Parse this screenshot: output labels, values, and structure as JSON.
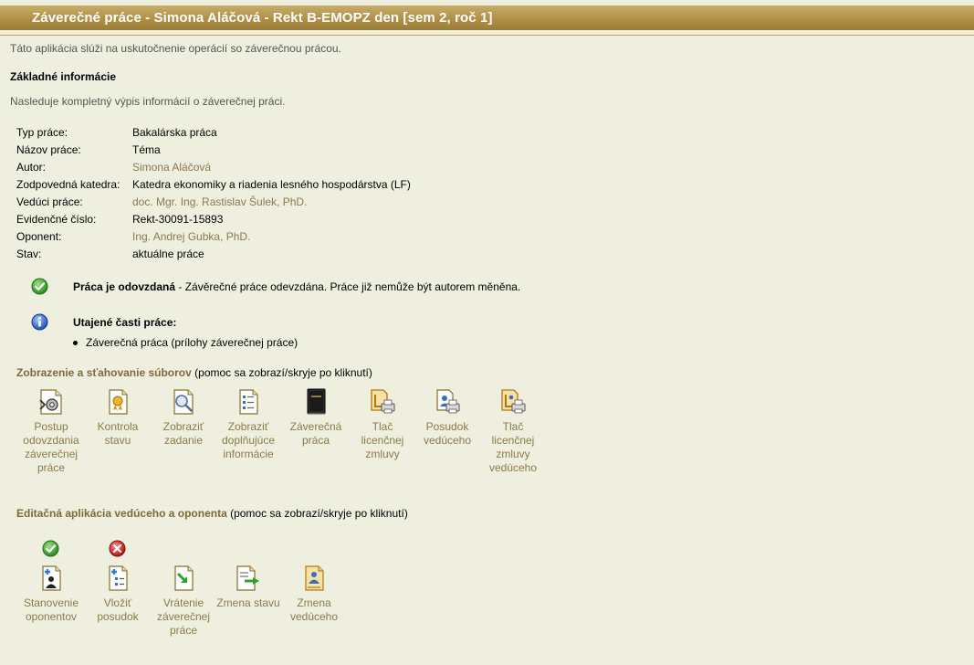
{
  "header": {
    "title": "Záverečné práce - Simona Aláčová - Rekt B-EMOPZ den [sem 2, roč 1]"
  },
  "intro": "Táto aplikácia slúži na uskutočnenie operácií so záverečnou prácou.",
  "basic_info": {
    "heading": "Základné informácie",
    "subtext": "Nasleduje kompletný výpis informácií o záverečnej práci.",
    "rows": [
      {
        "label": "Typ práce:",
        "value": "Bakalárska práca"
      },
      {
        "label": "Názov práce:",
        "value": "Téma"
      },
      {
        "label": "Autor:",
        "value": "Simona Aláčová"
      },
      {
        "label": "Zodpovedná katedra:",
        "value": "Katedra ekonomiky a riadenia lesného hospodárstva (LF)"
      },
      {
        "label": "Vedúci práce:",
        "value": "doc. Mgr. Ing. Rastislav Šulek, PhD."
      },
      {
        "label": "Evidenčné číslo:",
        "value": "Rekt-30091-15893"
      },
      {
        "label": "Oponent:",
        "value": "Ing. Andrej Gubka, PhD."
      },
      {
        "label": "Stav:",
        "value": "aktuálne práce"
      }
    ]
  },
  "notices": {
    "submitted_bold": "Práca je odovzdaná",
    "submitted_rest": " - Závěrečné práce odevzdána. Práce již nemůže být autorem měněna.",
    "secret_heading": "Utajené časti práce:",
    "secret_item": "Záverečná práca (prílohy záverečnej práce)"
  },
  "files_section": {
    "title": "Zobrazenie a sťahovanie súborov",
    "help": " (pomoc sa zobrazí/skryje po kliknutí)",
    "items": [
      {
        "label": "Postup odovzdania záverečnej práce",
        "icon": "process-gear-icon"
      },
      {
        "label": "Kontrola stavu",
        "icon": "certificate-icon"
      },
      {
        "label": "Zobraziť zadanie",
        "icon": "magnifier-doc-icon"
      },
      {
        "label": "Zobraziť doplňujúce informácie",
        "icon": "info-doc-icon"
      },
      {
        "label": "Záverečná práca",
        "icon": "book-icon"
      },
      {
        "label": "Tlač licenčnej zmluvy",
        "icon": "print-contract-icon"
      },
      {
        "label": "Posudok vedúceho",
        "icon": "print-review-icon"
      },
      {
        "label": "Tlač licenčnej zmluvy vedúceho",
        "icon": "print-contract-supervisor-icon"
      }
    ]
  },
  "edit_section": {
    "title": "Editačná aplikácia vedúceho a oponenta",
    "help": " (pomoc sa zobrazí/skryje po kliknutí)",
    "items": [
      {
        "label": "Stanovenie oponentov",
        "icon": "assign-opponent-icon",
        "status": "ok"
      },
      {
        "label": "Vložiť posudok",
        "icon": "insert-review-icon",
        "status": "error"
      },
      {
        "label": "Vrátenie záverečnej práce",
        "icon": "return-thesis-icon",
        "status": ""
      },
      {
        "label": "Zmena stavu",
        "icon": "change-state-icon",
        "status": ""
      },
      {
        "label": "Zmena vedúceho",
        "icon": "change-supervisor-icon",
        "status": ""
      }
    ]
  },
  "colors": {
    "title_bar": "#b08f45",
    "background": "#efefe0",
    "link": "#8a7a4a",
    "ok": "#2e9e2e",
    "error": "#c91c1c"
  }
}
